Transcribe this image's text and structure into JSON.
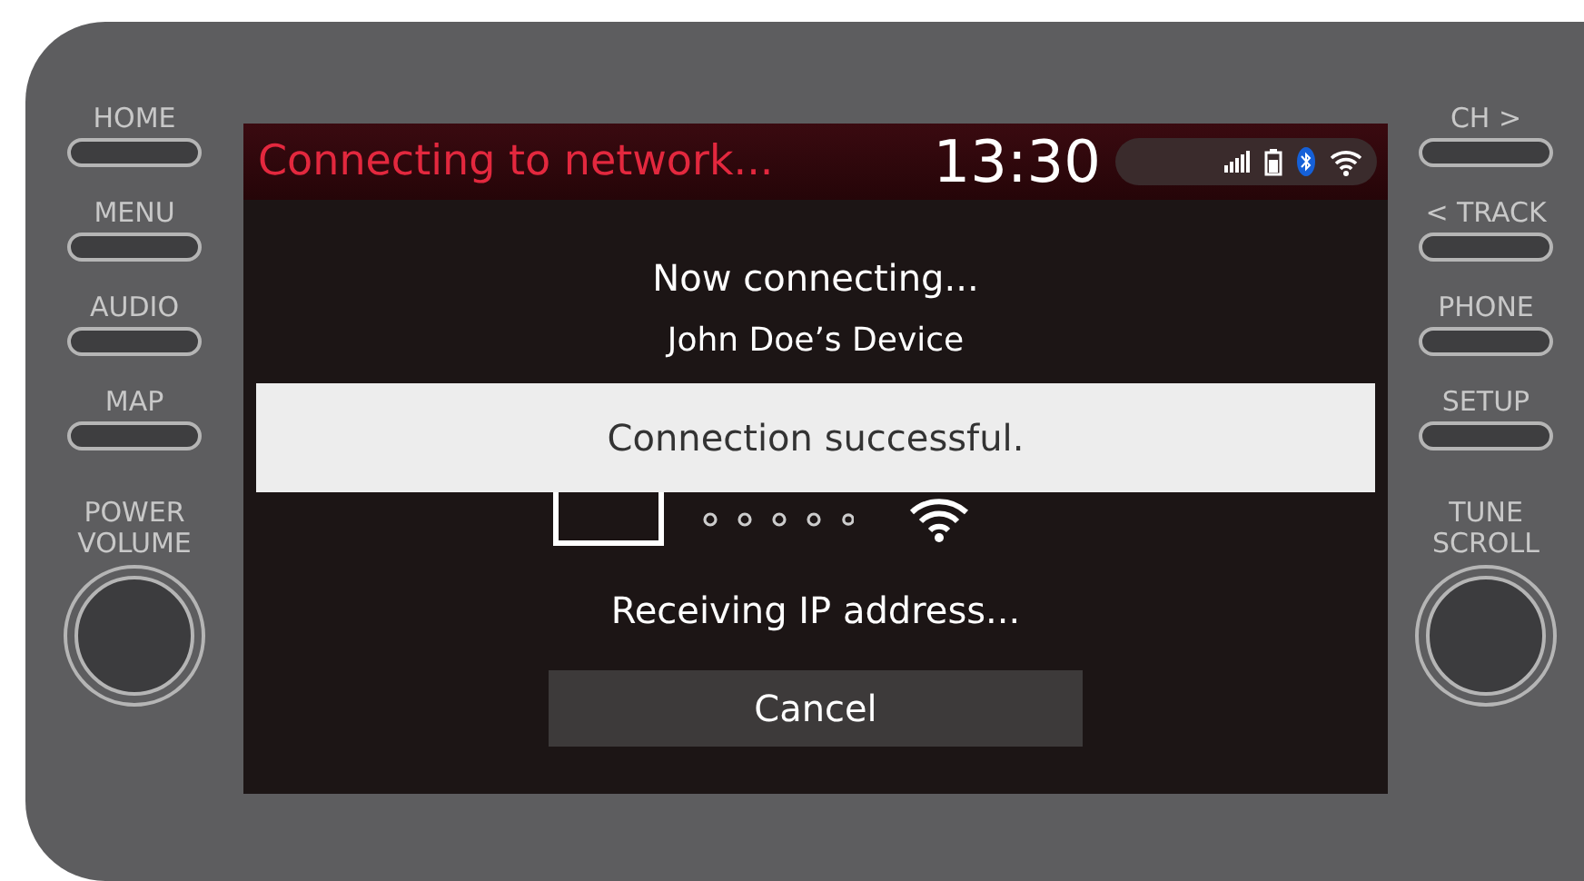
{
  "left_buttons": [
    {
      "label": "HOME"
    },
    {
      "label": "MENU"
    },
    {
      "label": "AUDIO"
    },
    {
      "label": "MAP"
    }
  ],
  "left_knob": {
    "label": "POWER VOLUME"
  },
  "right_buttons": [
    {
      "label": "CH >"
    },
    {
      "label": "< TRACK"
    },
    {
      "label": "PHONE"
    },
    {
      "label": "SETUP"
    }
  ],
  "right_knob": {
    "label": "TUNE SCROLL"
  },
  "screen": {
    "header": {
      "title": "Connecting to network...",
      "time": "13:30"
    },
    "status_line": "Now connecting...",
    "device_name": "John Doe’s Device",
    "banner": "Connection successful.",
    "progress_text": "Receiving IP address...",
    "cancel_button": "Cancel"
  }
}
